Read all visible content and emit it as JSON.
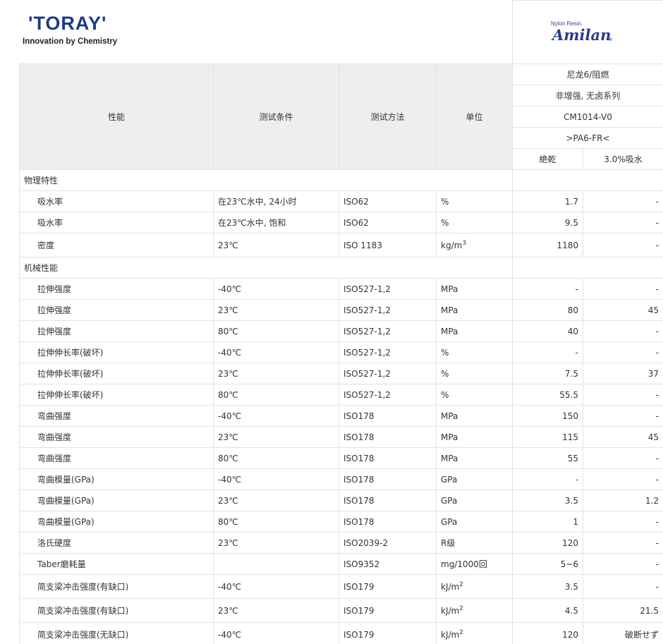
{
  "brand": {
    "logo_text": "'TORAY'",
    "tagline": "Innovation by Chemistry",
    "product_caption": "Nylon Resin",
    "product_logo": "Amilan",
    "product_mark": "®"
  },
  "header": {
    "columns": [
      "性能",
      "测试条件",
      "测试方法",
      "单位"
    ],
    "grade_lines": [
      "尼龙6/阻燃",
      "非增强, 无卤系列",
      "CM1014-V0",
      ">PA6-FR<"
    ],
    "conditions": [
      "絶乾",
      "3.0%吸水"
    ]
  },
  "sections": [
    {
      "title": "物理特性",
      "rows": [
        {
          "prop": "吸水率",
          "cond": "在23℃水中, 24小时",
          "method": "ISO62",
          "unit": "%",
          "dry": "1.7",
          "wet": "-"
        },
        {
          "prop": "吸水率",
          "cond": "在23℃水中, 饱和",
          "method": "ISO62",
          "unit": "%",
          "dry": "9.5",
          "wet": "-"
        },
        {
          "prop": "密度",
          "cond": "23℃",
          "method": "ISO 1183",
          "unit": "kg/m",
          "unit_sup": "3",
          "dry": "1180",
          "wet": "-"
        }
      ]
    },
    {
      "title": "机械性能",
      "rows": [
        {
          "prop": "拉伸强度",
          "cond": "-40℃",
          "method": "ISO527-1,2",
          "unit": "MPa",
          "dry": "-",
          "wet": "-"
        },
        {
          "prop": "拉伸强度",
          "cond": "23℃",
          "method": "ISO527-1,2",
          "unit": "MPa",
          "dry": "80",
          "wet": "45"
        },
        {
          "prop": "拉伸强度",
          "cond": "80℃",
          "method": "ISO527-1,2",
          "unit": "MPa",
          "dry": "40",
          "wet": "-"
        },
        {
          "prop": "拉伸伸长率(破坏)",
          "cond": "-40℃",
          "method": "ISO527-1,2",
          "unit": "%",
          "dry": "-",
          "wet": "-"
        },
        {
          "prop": "拉伸伸长率(破坏)",
          "cond": "23℃",
          "method": "ISO527-1,2",
          "unit": "%",
          "dry": "7.5",
          "wet": "37"
        },
        {
          "prop": "拉伸伸长率(破坏)",
          "cond": "80℃",
          "method": "ISO527-1,2",
          "unit": "%",
          "dry": "55.5",
          "wet": "-"
        },
        {
          "prop": "弯曲强度",
          "cond": "-40℃",
          "method": "ISO178",
          "unit": "MPa",
          "dry": "150",
          "wet": "-"
        },
        {
          "prop": "弯曲强度",
          "cond": "23℃",
          "method": "ISO178",
          "unit": "MPa",
          "dry": "115",
          "wet": "45"
        },
        {
          "prop": "弯曲强度",
          "cond": "80℃",
          "method": "ISO178",
          "unit": "MPa",
          "dry": "55",
          "wet": "-"
        },
        {
          "prop": "弯曲模量(GPa)",
          "cond": "-40℃",
          "method": "ISO178",
          "unit": "GPa",
          "dry": "-",
          "wet": "-"
        },
        {
          "prop": "弯曲模量(GPa)",
          "cond": "23℃",
          "method": "ISO178",
          "unit": "GPa",
          "dry": "3.5",
          "wet": "1.2"
        },
        {
          "prop": "弯曲模量(GPa)",
          "cond": "80℃",
          "method": "ISO178",
          "unit": "GPa",
          "dry": "1",
          "wet": "-"
        },
        {
          "prop": "洛氏硬度",
          "cond": "23℃",
          "method": "ISO2039-2",
          "unit": "R级",
          "dry": "120",
          "wet": "-"
        },
        {
          "prop": "Taber磨耗量",
          "cond": "",
          "method": "ISO9352",
          "unit": "mg/1000回",
          "dry": "5~6",
          "wet": "-"
        },
        {
          "prop": "简支梁冲击强度(有缺口)",
          "cond": "-40℃",
          "method": "ISO179",
          "unit": "kJ/m",
          "unit_sup": "2",
          "dry": "3.5",
          "wet": "-"
        },
        {
          "prop": "简支梁冲击强度(有缺口)",
          "cond": "23℃",
          "method": "ISO179",
          "unit": "kJ/m",
          "unit_sup": "2",
          "dry": "4.5",
          "wet": "21.5"
        },
        {
          "prop": "简支梁冲击强度(无缺口)",
          "cond": "-40℃",
          "method": "ISO179",
          "unit": "kJ/m",
          "unit_sup": "2",
          "dry": "120",
          "wet": "破断せず"
        }
      ]
    }
  ]
}
